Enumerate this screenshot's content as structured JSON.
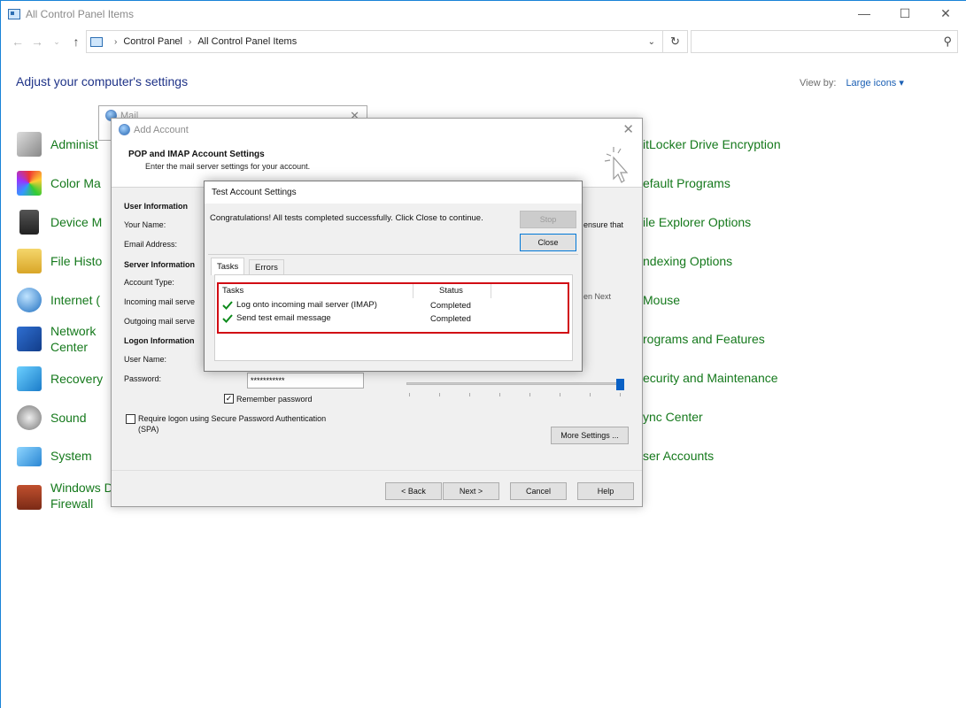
{
  "window": {
    "title": "All Control Panel Items",
    "controls": {
      "minimize": "—",
      "maximize": "☐",
      "close": "✕"
    }
  },
  "address": {
    "path": [
      "Control Panel",
      "All Control Panel Items"
    ],
    "search_placeholder": ""
  },
  "heading": "Adjust your computer's settings",
  "view_by": {
    "label": "View by:",
    "value": "Large icons"
  },
  "left_items": [
    "Administ",
    "Color Ma",
    "Device M",
    "File Histo",
    "Internet (",
    "Network",
    "Recovery",
    "Sound",
    "System",
    "Windows D"
  ],
  "left_items_second_line": {
    "network": "Center",
    "windows": "Firewall"
  },
  "right_items": [
    "itLocker Drive Encryption",
    "efault Programs",
    "ile Explorer Options",
    "ndexing Options",
    "Mouse",
    "rograms and Features",
    "ecurity and Maintenance",
    "ync Center",
    "ser Accounts"
  ],
  "mail_window": {
    "title": "Mail"
  },
  "add_account": {
    "title": "Add Account",
    "header": "POP and IMAP Account Settings",
    "subheader": "Enter the mail server settings for your account.",
    "user_info": "User Information",
    "your_name": "Your Name:",
    "email_address": "Email Address:",
    "server_info": "Server Information",
    "account_type": "Account Type:",
    "incoming": "Incoming mail serve",
    "outgoing": "Outgoing mail serve",
    "logon_info": "Logon Information",
    "user_name": "User Name:",
    "password": "Password:",
    "password_value": "***********",
    "remember_password": "Remember password",
    "spa_line1": "Require logon using Secure Password Authentication",
    "spa_line2": "(SPA)",
    "ensure_that": "ensure that",
    "en_next": "en Next",
    "more_settings": "More Settings ...",
    "back": "< Back",
    "next": "Next >",
    "cancel": "Cancel",
    "help": "Help"
  },
  "test_settings": {
    "title": "Test Account Settings",
    "message": "Congratulations! All tests completed successfully. Click Close to continue.",
    "stop": "Stop",
    "close": "Close",
    "tabs": [
      "Tasks",
      "Errors"
    ],
    "columns": [
      "Tasks",
      "Status"
    ],
    "rows": [
      {
        "task": "Log onto incoming mail server (IMAP)",
        "status": "Completed"
      },
      {
        "task": "Send test email message",
        "status": "Completed"
      }
    ]
  }
}
